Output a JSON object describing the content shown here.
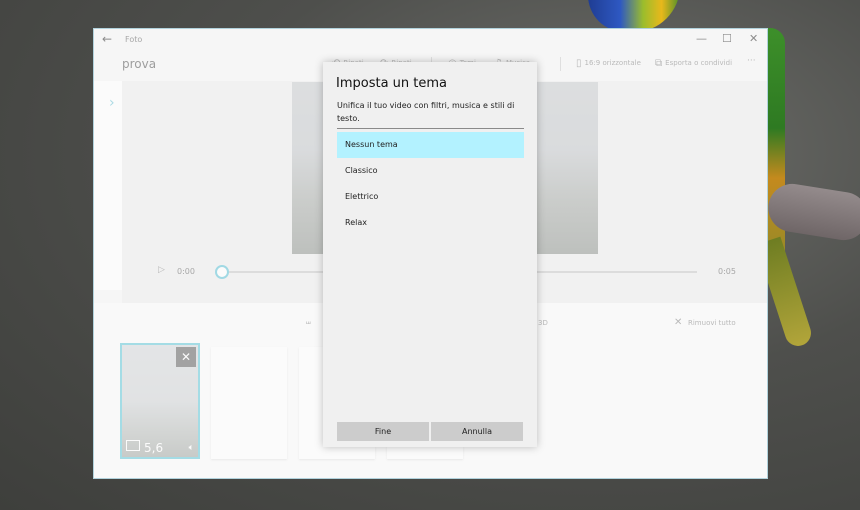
{
  "window": {
    "app_title": "Foto",
    "project_title": "prova",
    "back_icon": "←",
    "minimize_icon": "—",
    "maximize_icon": "☐",
    "close_icon": "✕"
  },
  "toolbar": {
    "undo_label": "Ripeti",
    "redo_label": "Ripeti",
    "themes_label": "Temi",
    "music_label": "Musica",
    "aspect_label": "16:9 orizzontale",
    "export_label": "Esporta o condividi",
    "more_label": "···"
  },
  "player": {
    "time_start": "0:00",
    "time_end": "0:05",
    "progress": 0
  },
  "storyboard": {
    "partial_3d_label": "3D",
    "remove_all_label": "Rimuovi tutto",
    "card_duration": "5,6"
  },
  "dialog": {
    "title": "Imposta un tema",
    "description": "Unifica il tuo video con filtri, musica e stili di testo.",
    "themes": [
      "Nessun tema",
      "Classico",
      "Elettrico",
      "Relax"
    ],
    "selected_index": 0,
    "done_label": "Fine",
    "cancel_label": "Annulla"
  },
  "colors": {
    "accent": "#5cc1d6",
    "selection": "#b3f2ff"
  }
}
